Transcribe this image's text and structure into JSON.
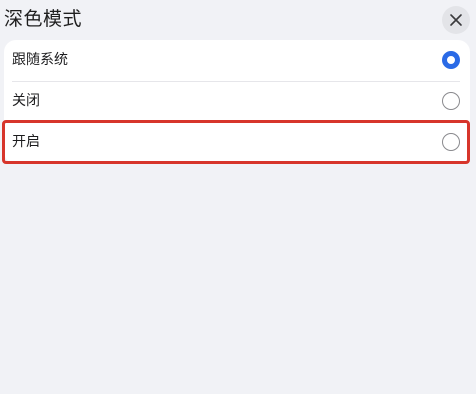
{
  "header": {
    "title": "深色模式",
    "close_icon": "close-icon"
  },
  "options": [
    {
      "label": "跟随系统",
      "selected": true
    },
    {
      "label": "关闭",
      "selected": false
    },
    {
      "label": "开启",
      "selected": false
    }
  ],
  "colors": {
    "accent": "#2a6ae6",
    "highlight": "#d7352b",
    "background": "#f1f2f6"
  }
}
